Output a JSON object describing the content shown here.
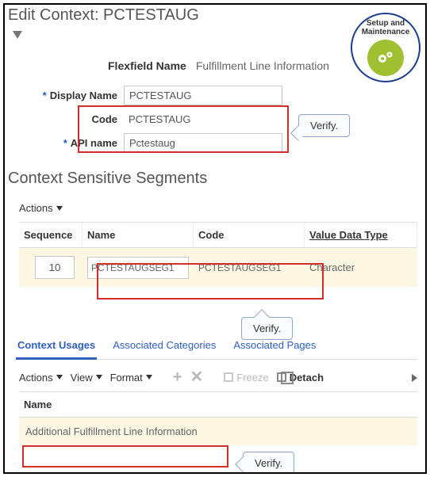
{
  "title": "Edit Context: PCTESTAUG",
  "badge": {
    "line1": "Setup and",
    "line2": "Maintenance"
  },
  "flexfield": {
    "label": "Flexfield Name",
    "value": "Fulfillment Line Information"
  },
  "fields": {
    "display_name": {
      "label": "Display Name",
      "value": "PCTESTAUG"
    },
    "code": {
      "label": "Code",
      "value": "PCTESTAUG"
    },
    "api_name": {
      "label": "API name",
      "value": "Pctestaug"
    }
  },
  "callout_verify": "Verify.",
  "segments": {
    "heading": "Context Sensitive Segments",
    "actions_label": "Actions",
    "columns": {
      "sequence": "Sequence",
      "name": "Name",
      "code": "Code",
      "vdt": "Value Data Type"
    },
    "rows": [
      {
        "sequence": "10",
        "name": "PCTESTAUGSEG1",
        "code": "PCTESTAUGSEG1",
        "vdt": "Character"
      }
    ]
  },
  "tabs": {
    "usages": "Context Usages",
    "categories": "Associated Categories",
    "pages": "Associated Pages"
  },
  "toolbar": {
    "actions": "Actions",
    "view": "View",
    "format": "Format",
    "freeze": "Freeze",
    "detach": "Detach"
  },
  "usages_table": {
    "col_name": "Name",
    "rows": [
      {
        "name": "Additional Fulfillment Line Information"
      }
    ]
  }
}
